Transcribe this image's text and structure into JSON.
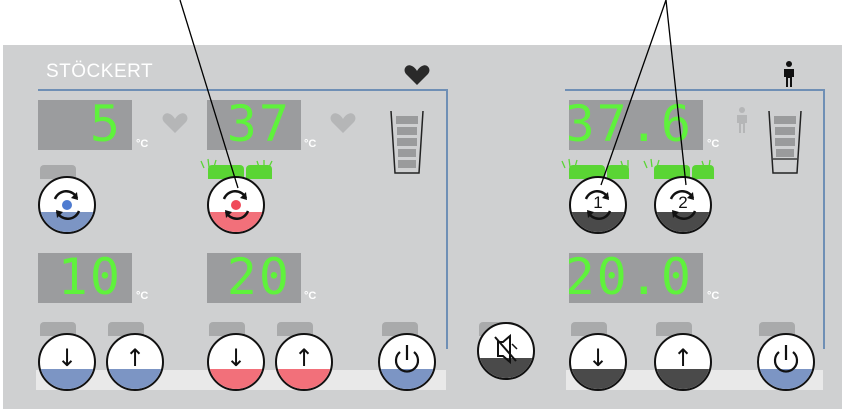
{
  "brand": "STÖCKERT",
  "unit_label": "°C",
  "displays": {
    "left_1": "5",
    "left_2": "37",
    "left_3": "10",
    "left_4": "20",
    "right_1": "37.6",
    "right_2": "20.0"
  },
  "icons": {
    "left_section": "heart-icon",
    "right_section": "person-icon",
    "mute": "speaker-mute-icon",
    "power": "power-icon",
    "cycle": "cycle-arrows-icon",
    "up": "arrow-up-icon",
    "down": "arrow-down-icon"
  },
  "buttons": {
    "up_label": "↑",
    "down_label": "↓",
    "pump1_label": "1",
    "pump2_label": "2"
  },
  "colors": {
    "blue": "#7c95c4",
    "red": "#f2707a",
    "dark": "#4a4a4a",
    "display_digits": "#5ff23c",
    "panel": "#cfd0d1"
  }
}
